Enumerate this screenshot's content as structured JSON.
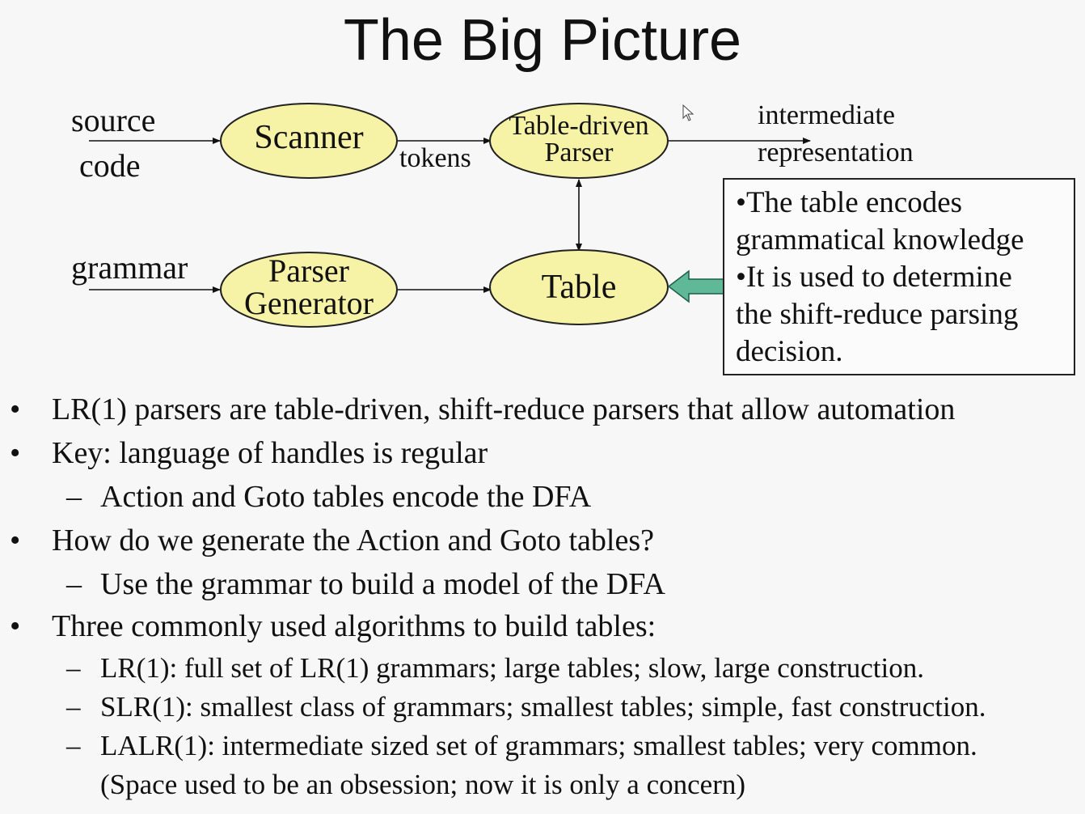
{
  "slide": {
    "title": "The Big Picture"
  },
  "diagram": {
    "inputs": {
      "source_line1": "source",
      "source_line2": "code",
      "grammar": "grammar"
    },
    "nodes": {
      "scanner": "Scanner",
      "parser_line1": "Table-driven",
      "parser_line2": "Parser",
      "generator_line1": "Parser",
      "generator_line2": "Generator",
      "table": "Table"
    },
    "edge_labels": {
      "tokens": "tokens",
      "output_line1": "intermediate",
      "output_line2": "representation"
    },
    "colors": {
      "node_fill": "#f7f3a6",
      "callout_arrow": "#5fb898"
    },
    "callout": {
      "lines": [
        "•The table encodes",
        "grammatical knowledge",
        "•It is used to determine",
        "the shift-reduce parsing",
        "decision."
      ]
    }
  },
  "bullets": [
    {
      "level": 1,
      "marker": "•",
      "text": "LR(1) parsers are table-driven, shift-reduce parsers that allow automation"
    },
    {
      "level": 1,
      "marker": "•",
      "text": "Key: language of handles is regular"
    },
    {
      "level": 2,
      "marker": "–",
      "text": "Action and Goto tables encode the DFA"
    },
    {
      "level": 1,
      "marker": "•",
      "text": "How do we generate the Action and Goto tables?"
    },
    {
      "level": 2,
      "marker": "–",
      "text": "Use the grammar to build a model of the DFA"
    },
    {
      "level": 1,
      "marker": "•",
      "text": "Three commonly used algorithms to build tables:"
    },
    {
      "level": 2,
      "marker": "–",
      "text": "LR(1): full set of LR(1) grammars; large tables; slow, large construction."
    },
    {
      "level": 2,
      "marker": "–",
      "text": "SLR(1): smallest class of grammars; smallest tables; simple, fast construction."
    },
    {
      "level": 2,
      "marker": "–",
      "text": "LALR(1): intermediate sized set of grammars; smallest tables; very common."
    },
    {
      "level": 2,
      "marker": "",
      "text": "(Space used to be an obsession; now it is only a concern)"
    }
  ]
}
